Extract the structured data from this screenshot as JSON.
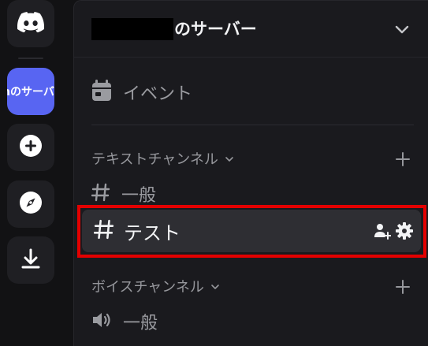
{
  "server": {
    "name_suffix": "のサーバー",
    "rail_label": "nのサーバー"
  },
  "events": {
    "label": "イベント"
  },
  "categories": [
    {
      "label": "テキストチャンネル"
    },
    {
      "label": "ボイスチャンネル"
    }
  ],
  "channels": {
    "text_general": "一般",
    "text_test": "テスト",
    "voice_general": "一般"
  },
  "colors": {
    "accent": "#5865f2",
    "highlight": "#e30000",
    "selected_bg": "#2e2e33"
  },
  "icons": {
    "rail": [
      "discord-logo-icon",
      "add-server-icon",
      "discover-icon",
      "download-icon"
    ],
    "channel_actions": [
      "invite-user-icon",
      "gear-icon"
    ]
  }
}
